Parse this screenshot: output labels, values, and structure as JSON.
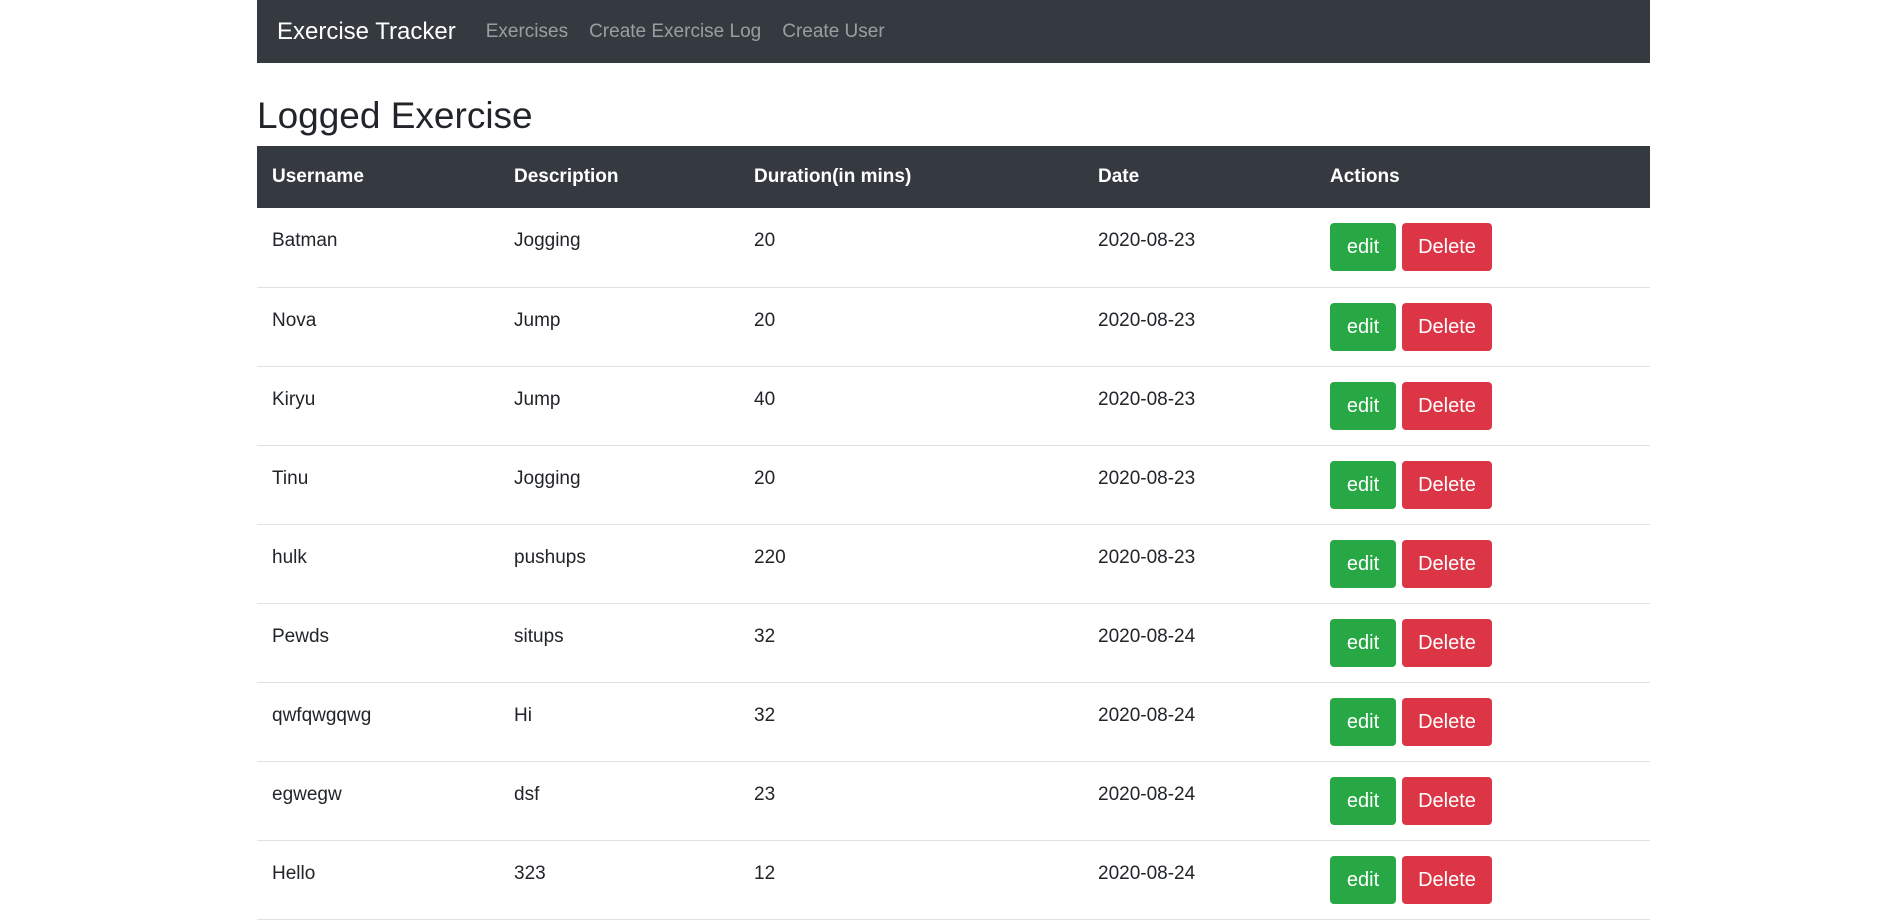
{
  "navbar": {
    "brand": "Exercise Tracker",
    "links": [
      "Exercises",
      "Create Exercise Log",
      "Create User"
    ]
  },
  "page_title": "Logged Exercise",
  "table": {
    "headers": [
      "Username",
      "Description",
      "Duration(in mins)",
      "Date",
      "Actions"
    ],
    "edit_label": "edit",
    "delete_label": "Delete",
    "rows": [
      {
        "username": "Batman",
        "description": "Jogging",
        "duration": "20",
        "date": "2020-08-23"
      },
      {
        "username": "Nova",
        "description": "Jump",
        "duration": "20",
        "date": "2020-08-23"
      },
      {
        "username": "Kiryu",
        "description": "Jump",
        "duration": "40",
        "date": "2020-08-23"
      },
      {
        "username": "Tinu",
        "description": "Jogging",
        "duration": "20",
        "date": "2020-08-23"
      },
      {
        "username": "hulk",
        "description": "pushups",
        "duration": "220",
        "date": "2020-08-23"
      },
      {
        "username": "Pewds",
        "description": "situps",
        "duration": "32",
        "date": "2020-08-24"
      },
      {
        "username": "qwfqwgqwg",
        "description": "Hi",
        "duration": "32",
        "date": "2020-08-24"
      },
      {
        "username": "egwegw",
        "description": "dsf",
        "duration": "23",
        "date": "2020-08-24"
      },
      {
        "username": "Hello",
        "description": "323",
        "duration": "12",
        "date": "2020-08-24"
      }
    ]
  },
  "colors": {
    "navbar_bg": "#343a40",
    "edit_button": "#28a745",
    "delete_button": "#dc3545"
  }
}
